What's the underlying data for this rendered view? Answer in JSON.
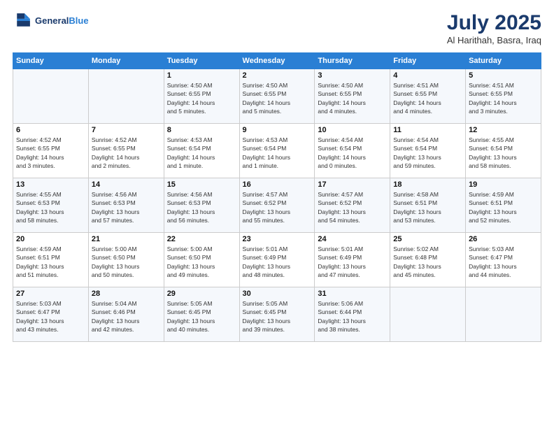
{
  "header": {
    "logo_line1": "General",
    "logo_line2": "Blue",
    "title": "July 2025",
    "location": "Al Harithah, Basra, Iraq"
  },
  "days_of_week": [
    "Sunday",
    "Monday",
    "Tuesday",
    "Wednesday",
    "Thursday",
    "Friday",
    "Saturday"
  ],
  "weeks": [
    [
      {
        "day": "",
        "info": ""
      },
      {
        "day": "",
        "info": ""
      },
      {
        "day": "1",
        "info": "Sunrise: 4:50 AM\nSunset: 6:55 PM\nDaylight: 14 hours\nand 5 minutes."
      },
      {
        "day": "2",
        "info": "Sunrise: 4:50 AM\nSunset: 6:55 PM\nDaylight: 14 hours\nand 5 minutes."
      },
      {
        "day": "3",
        "info": "Sunrise: 4:50 AM\nSunset: 6:55 PM\nDaylight: 14 hours\nand 4 minutes."
      },
      {
        "day": "4",
        "info": "Sunrise: 4:51 AM\nSunset: 6:55 PM\nDaylight: 14 hours\nand 4 minutes."
      },
      {
        "day": "5",
        "info": "Sunrise: 4:51 AM\nSunset: 6:55 PM\nDaylight: 14 hours\nand 3 minutes."
      }
    ],
    [
      {
        "day": "6",
        "info": "Sunrise: 4:52 AM\nSunset: 6:55 PM\nDaylight: 14 hours\nand 3 minutes."
      },
      {
        "day": "7",
        "info": "Sunrise: 4:52 AM\nSunset: 6:55 PM\nDaylight: 14 hours\nand 2 minutes."
      },
      {
        "day": "8",
        "info": "Sunrise: 4:53 AM\nSunset: 6:54 PM\nDaylight: 14 hours\nand 1 minute."
      },
      {
        "day": "9",
        "info": "Sunrise: 4:53 AM\nSunset: 6:54 PM\nDaylight: 14 hours\nand 1 minute."
      },
      {
        "day": "10",
        "info": "Sunrise: 4:54 AM\nSunset: 6:54 PM\nDaylight: 14 hours\nand 0 minutes."
      },
      {
        "day": "11",
        "info": "Sunrise: 4:54 AM\nSunset: 6:54 PM\nDaylight: 13 hours\nand 59 minutes."
      },
      {
        "day": "12",
        "info": "Sunrise: 4:55 AM\nSunset: 6:54 PM\nDaylight: 13 hours\nand 58 minutes."
      }
    ],
    [
      {
        "day": "13",
        "info": "Sunrise: 4:55 AM\nSunset: 6:53 PM\nDaylight: 13 hours\nand 58 minutes."
      },
      {
        "day": "14",
        "info": "Sunrise: 4:56 AM\nSunset: 6:53 PM\nDaylight: 13 hours\nand 57 minutes."
      },
      {
        "day": "15",
        "info": "Sunrise: 4:56 AM\nSunset: 6:53 PM\nDaylight: 13 hours\nand 56 minutes."
      },
      {
        "day": "16",
        "info": "Sunrise: 4:57 AM\nSunset: 6:52 PM\nDaylight: 13 hours\nand 55 minutes."
      },
      {
        "day": "17",
        "info": "Sunrise: 4:57 AM\nSunset: 6:52 PM\nDaylight: 13 hours\nand 54 minutes."
      },
      {
        "day": "18",
        "info": "Sunrise: 4:58 AM\nSunset: 6:51 PM\nDaylight: 13 hours\nand 53 minutes."
      },
      {
        "day": "19",
        "info": "Sunrise: 4:59 AM\nSunset: 6:51 PM\nDaylight: 13 hours\nand 52 minutes."
      }
    ],
    [
      {
        "day": "20",
        "info": "Sunrise: 4:59 AM\nSunset: 6:51 PM\nDaylight: 13 hours\nand 51 minutes."
      },
      {
        "day": "21",
        "info": "Sunrise: 5:00 AM\nSunset: 6:50 PM\nDaylight: 13 hours\nand 50 minutes."
      },
      {
        "day": "22",
        "info": "Sunrise: 5:00 AM\nSunset: 6:50 PM\nDaylight: 13 hours\nand 49 minutes."
      },
      {
        "day": "23",
        "info": "Sunrise: 5:01 AM\nSunset: 6:49 PM\nDaylight: 13 hours\nand 48 minutes."
      },
      {
        "day": "24",
        "info": "Sunrise: 5:01 AM\nSunset: 6:49 PM\nDaylight: 13 hours\nand 47 minutes."
      },
      {
        "day": "25",
        "info": "Sunrise: 5:02 AM\nSunset: 6:48 PM\nDaylight: 13 hours\nand 45 minutes."
      },
      {
        "day": "26",
        "info": "Sunrise: 5:03 AM\nSunset: 6:47 PM\nDaylight: 13 hours\nand 44 minutes."
      }
    ],
    [
      {
        "day": "27",
        "info": "Sunrise: 5:03 AM\nSunset: 6:47 PM\nDaylight: 13 hours\nand 43 minutes."
      },
      {
        "day": "28",
        "info": "Sunrise: 5:04 AM\nSunset: 6:46 PM\nDaylight: 13 hours\nand 42 minutes."
      },
      {
        "day": "29",
        "info": "Sunrise: 5:05 AM\nSunset: 6:45 PM\nDaylight: 13 hours\nand 40 minutes."
      },
      {
        "day": "30",
        "info": "Sunrise: 5:05 AM\nSunset: 6:45 PM\nDaylight: 13 hours\nand 39 minutes."
      },
      {
        "day": "31",
        "info": "Sunrise: 5:06 AM\nSunset: 6:44 PM\nDaylight: 13 hours\nand 38 minutes."
      },
      {
        "day": "",
        "info": ""
      },
      {
        "day": "",
        "info": ""
      }
    ]
  ]
}
